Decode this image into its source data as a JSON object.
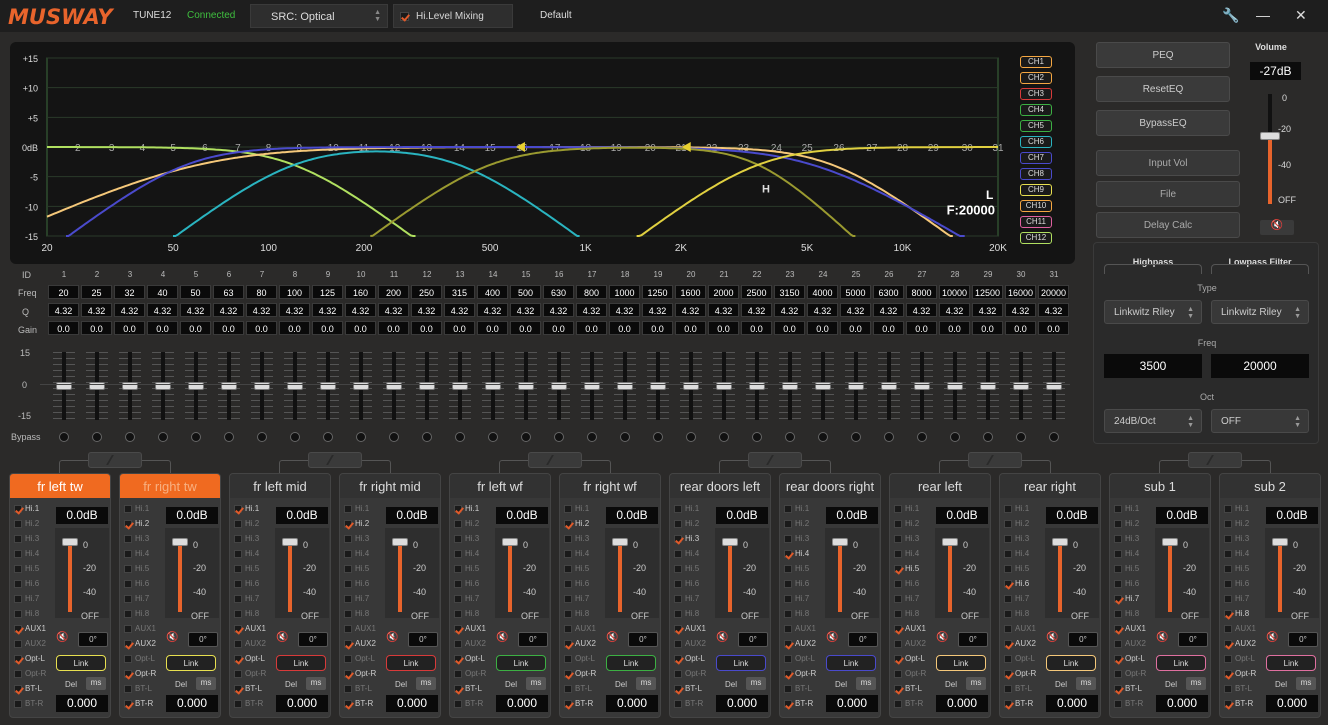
{
  "app": {
    "logo": "MUSWAY",
    "model": "TUNE12",
    "status": "Connected",
    "status_color": "#3fbf3f",
    "accent": "#e8642c"
  },
  "src": {
    "label": "SRC:",
    "value": "Optical"
  },
  "hl_mixing": {
    "label": "Hi.Level Mixing",
    "checked": true
  },
  "preset": "Default",
  "graph": {
    "y_ticks": [
      "+15",
      "+10",
      "+5",
      "0dB",
      "-5",
      "-10",
      "-15"
    ],
    "x_ticks": [
      "20",
      "50",
      "100",
      "200",
      "500",
      "1K",
      "2K",
      "5K",
      "10K",
      "20K"
    ],
    "band_labels": [
      "2",
      "3",
      "4",
      "5",
      "6",
      "7",
      "8",
      "9",
      "10",
      "11",
      "12",
      "13",
      "14",
      "15",
      "16",
      "17",
      "18",
      "19",
      "20",
      "21",
      "22",
      "23",
      "24",
      "25",
      "26",
      "27",
      "28",
      "29",
      "30",
      "31"
    ],
    "marker_L": "L",
    "marker_H": "H",
    "freq_readout": "F:20000",
    "channels": [
      {
        "name": "CH1",
        "color": "#f5a742"
      },
      {
        "name": "CH2",
        "color": "#f5a742"
      },
      {
        "name": "CH3",
        "color": "#d83a3a"
      },
      {
        "name": "CH4",
        "color": "#3cb043"
      },
      {
        "name": "CH5",
        "color": "#3cb043"
      },
      {
        "name": "CH6",
        "color": "#2ab4c0"
      },
      {
        "name": "CH7",
        "color": "#4a4acc"
      },
      {
        "name": "CH8",
        "color": "#4a4acc"
      },
      {
        "name": "CH9",
        "color": "#e8e050"
      },
      {
        "name": "CH10",
        "color": "#f5a742"
      },
      {
        "name": "CH11",
        "color": "#e060a0"
      },
      {
        "name": "CH12",
        "color": "#b0e060"
      }
    ]
  },
  "right_buttons": {
    "peq": "PEQ",
    "reset": "ResetEQ",
    "bypass": "BypassEQ",
    "input_vol": "Input Vol",
    "file": "File",
    "delay": "Delay Calc"
  },
  "volume": {
    "title": "Volume",
    "value": "-27dB",
    "scale": [
      "0",
      "-20",
      "-40",
      "OFF"
    ],
    "level": 0.62
  },
  "eq": {
    "row_labels": {
      "id": "ID",
      "freq": "Freq",
      "q": "Q",
      "gain": "Gain",
      "bypass": "Bypass"
    },
    "slider_scale": [
      "15",
      "0",
      "-15"
    ],
    "ids": [
      "1",
      "2",
      "3",
      "4",
      "5",
      "6",
      "7",
      "8",
      "9",
      "10",
      "11",
      "12",
      "13",
      "14",
      "15",
      "16",
      "17",
      "18",
      "19",
      "20",
      "21",
      "22",
      "23",
      "24",
      "25",
      "26",
      "27",
      "28",
      "29",
      "30",
      "31"
    ],
    "freqs": [
      "20",
      "25",
      "32",
      "40",
      "50",
      "63",
      "80",
      "100",
      "125",
      "160",
      "200",
      "250",
      "315",
      "400",
      "500",
      "630",
      "800",
      "1000",
      "1250",
      "1600",
      "2000",
      "2500",
      "3150",
      "4000",
      "5000",
      "6300",
      "8000",
      "10000",
      "12500",
      "16000",
      "20000"
    ],
    "q": "4.32",
    "gain": "0.0"
  },
  "filter": {
    "hp_title": "Highpass",
    "lp_title": "Lowpass Filter",
    "type_label": "Type",
    "hp_type": "Linkwitz Riley",
    "lp_type": "Linkwitz Riley",
    "freq_label": "Freq",
    "hp_freq": "3500",
    "lp_freq": "20000",
    "oct_label": "Oct",
    "hp_oct": "24dB/Oct",
    "lp_oct": "OFF"
  },
  "sources": [
    "Hi.1",
    "Hi.2",
    "Hi.3",
    "Hi.4",
    "Hi.5",
    "Hi.6",
    "Hi.7",
    "Hi.8",
    "AUX1",
    "AUX2",
    "Opt-L",
    "Opt-R",
    "BT-L",
    "BT-R"
  ],
  "channels": [
    {
      "name": "fr left tw",
      "gain": "0.0dB",
      "phase": "0°",
      "link": "Link",
      "link_color": "#e8e050",
      "del": "Del",
      "ms": "ms",
      "delay": "0.000",
      "checked": [
        0,
        8,
        10,
        12
      ],
      "style": "active"
    },
    {
      "name": "fr right tw",
      "gain": "0.0dB",
      "phase": "0°",
      "link": "Link",
      "link_color": "#e8e050",
      "del": "Del",
      "ms": "ms",
      "delay": "0.000",
      "checked": [
        1,
        9,
        11,
        13
      ],
      "style": "act2"
    },
    {
      "name": "fr left mid",
      "gain": "0.0dB",
      "phase": "0°",
      "link": "Link",
      "link_color": "#d83a3a",
      "del": "Del",
      "ms": "ms",
      "delay": "0.000",
      "checked": [
        0,
        8,
        10,
        12
      ],
      "style": ""
    },
    {
      "name": "fr right mid",
      "gain": "0.0dB",
      "phase": "0°",
      "link": "Link",
      "link_color": "#d83a3a",
      "del": "Del",
      "ms": "ms",
      "delay": "0.000",
      "checked": [
        1,
        9,
        11,
        13
      ],
      "style": ""
    },
    {
      "name": "fr left wf",
      "gain": "0.0dB",
      "phase": "0°",
      "link": "Link",
      "link_color": "#3cb043",
      "del": "Del",
      "ms": "ms",
      "delay": "0.000",
      "checked": [
        0,
        8,
        10,
        12
      ],
      "style": ""
    },
    {
      "name": "fr right wf",
      "gain": "0.0dB",
      "phase": "0°",
      "link": "Link",
      "link_color": "#3cb043",
      "del": "Del",
      "ms": "ms",
      "delay": "0.000",
      "checked": [
        1,
        9,
        11,
        13
      ],
      "style": ""
    },
    {
      "name": "rear doors left",
      "gain": "0.0dB",
      "phase": "0°",
      "link": "Link",
      "link_color": "#4a4acc",
      "del": "Del",
      "ms": "ms",
      "delay": "0.000",
      "checked": [
        2,
        8,
        10,
        12
      ],
      "style": ""
    },
    {
      "name": "rear doors right",
      "gain": "0.0dB",
      "phase": "0°",
      "link": "Link",
      "link_color": "#4a4acc",
      "del": "Del",
      "ms": "ms",
      "delay": "0.000",
      "checked": [
        3,
        9,
        11,
        13
      ],
      "style": ""
    },
    {
      "name": "rear left",
      "gain": "0.0dB",
      "phase": "0°",
      "link": "Link",
      "link_color": "#f5c87a",
      "del": "Del",
      "ms": "ms",
      "delay": "0.000",
      "checked": [
        4,
        8,
        10,
        12
      ],
      "style": ""
    },
    {
      "name": "rear right",
      "gain": "0.0dB",
      "phase": "0°",
      "link": "Link",
      "link_color": "#f5c87a",
      "del": "Del",
      "ms": "ms",
      "delay": "0.000",
      "checked": [
        5,
        9,
        11,
        13
      ],
      "style": ""
    },
    {
      "name": "sub 1",
      "gain": "0.0dB",
      "phase": "0°",
      "link": "Link",
      "link_color": "#e070a0",
      "del": "Del",
      "ms": "ms",
      "delay": "0.000",
      "checked": [
        6,
        8,
        10,
        12
      ],
      "style": ""
    },
    {
      "name": "sub 2",
      "gain": "0.0dB",
      "phase": "0°",
      "link": "Link",
      "link_color": "#e070a0",
      "del": "Del",
      "ms": "ms",
      "delay": "0.000",
      "checked": [
        7,
        9,
        11,
        13
      ],
      "style": ""
    }
  ],
  "fader_scale": [
    "0",
    "-20",
    "-40",
    "OFF"
  ]
}
